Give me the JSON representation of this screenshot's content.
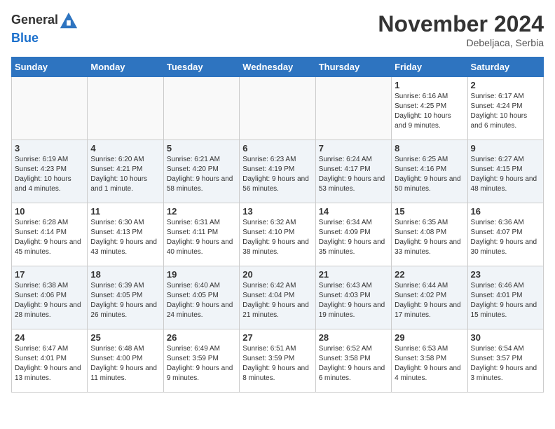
{
  "header": {
    "logo_general": "General",
    "logo_blue": "Blue",
    "month_title": "November 2024",
    "location": "Debeljaca, Serbia"
  },
  "weekdays": [
    "Sunday",
    "Monday",
    "Tuesday",
    "Wednesday",
    "Thursday",
    "Friday",
    "Saturday"
  ],
  "weeks": [
    [
      {
        "day": "",
        "info": ""
      },
      {
        "day": "",
        "info": ""
      },
      {
        "day": "",
        "info": ""
      },
      {
        "day": "",
        "info": ""
      },
      {
        "day": "",
        "info": ""
      },
      {
        "day": "1",
        "info": "Sunrise: 6:16 AM\nSunset: 4:25 PM\nDaylight: 10 hours and 9 minutes."
      },
      {
        "day": "2",
        "info": "Sunrise: 6:17 AM\nSunset: 4:24 PM\nDaylight: 10 hours and 6 minutes."
      }
    ],
    [
      {
        "day": "3",
        "info": "Sunrise: 6:19 AM\nSunset: 4:23 PM\nDaylight: 10 hours and 4 minutes."
      },
      {
        "day": "4",
        "info": "Sunrise: 6:20 AM\nSunset: 4:21 PM\nDaylight: 10 hours and 1 minute."
      },
      {
        "day": "5",
        "info": "Sunrise: 6:21 AM\nSunset: 4:20 PM\nDaylight: 9 hours and 58 minutes."
      },
      {
        "day": "6",
        "info": "Sunrise: 6:23 AM\nSunset: 4:19 PM\nDaylight: 9 hours and 56 minutes."
      },
      {
        "day": "7",
        "info": "Sunrise: 6:24 AM\nSunset: 4:17 PM\nDaylight: 9 hours and 53 minutes."
      },
      {
        "day": "8",
        "info": "Sunrise: 6:25 AM\nSunset: 4:16 PM\nDaylight: 9 hours and 50 minutes."
      },
      {
        "day": "9",
        "info": "Sunrise: 6:27 AM\nSunset: 4:15 PM\nDaylight: 9 hours and 48 minutes."
      }
    ],
    [
      {
        "day": "10",
        "info": "Sunrise: 6:28 AM\nSunset: 4:14 PM\nDaylight: 9 hours and 45 minutes."
      },
      {
        "day": "11",
        "info": "Sunrise: 6:30 AM\nSunset: 4:13 PM\nDaylight: 9 hours and 43 minutes."
      },
      {
        "day": "12",
        "info": "Sunrise: 6:31 AM\nSunset: 4:11 PM\nDaylight: 9 hours and 40 minutes."
      },
      {
        "day": "13",
        "info": "Sunrise: 6:32 AM\nSunset: 4:10 PM\nDaylight: 9 hours and 38 minutes."
      },
      {
        "day": "14",
        "info": "Sunrise: 6:34 AM\nSunset: 4:09 PM\nDaylight: 9 hours and 35 minutes."
      },
      {
        "day": "15",
        "info": "Sunrise: 6:35 AM\nSunset: 4:08 PM\nDaylight: 9 hours and 33 minutes."
      },
      {
        "day": "16",
        "info": "Sunrise: 6:36 AM\nSunset: 4:07 PM\nDaylight: 9 hours and 30 minutes."
      }
    ],
    [
      {
        "day": "17",
        "info": "Sunrise: 6:38 AM\nSunset: 4:06 PM\nDaylight: 9 hours and 28 minutes."
      },
      {
        "day": "18",
        "info": "Sunrise: 6:39 AM\nSunset: 4:05 PM\nDaylight: 9 hours and 26 minutes."
      },
      {
        "day": "19",
        "info": "Sunrise: 6:40 AM\nSunset: 4:05 PM\nDaylight: 9 hours and 24 minutes."
      },
      {
        "day": "20",
        "info": "Sunrise: 6:42 AM\nSunset: 4:04 PM\nDaylight: 9 hours and 21 minutes."
      },
      {
        "day": "21",
        "info": "Sunrise: 6:43 AM\nSunset: 4:03 PM\nDaylight: 9 hours and 19 minutes."
      },
      {
        "day": "22",
        "info": "Sunrise: 6:44 AM\nSunset: 4:02 PM\nDaylight: 9 hours and 17 minutes."
      },
      {
        "day": "23",
        "info": "Sunrise: 6:46 AM\nSunset: 4:01 PM\nDaylight: 9 hours and 15 minutes."
      }
    ],
    [
      {
        "day": "24",
        "info": "Sunrise: 6:47 AM\nSunset: 4:01 PM\nDaylight: 9 hours and 13 minutes."
      },
      {
        "day": "25",
        "info": "Sunrise: 6:48 AM\nSunset: 4:00 PM\nDaylight: 9 hours and 11 minutes."
      },
      {
        "day": "26",
        "info": "Sunrise: 6:49 AM\nSunset: 3:59 PM\nDaylight: 9 hours and 9 minutes."
      },
      {
        "day": "27",
        "info": "Sunrise: 6:51 AM\nSunset: 3:59 PM\nDaylight: 9 hours and 8 minutes."
      },
      {
        "day": "28",
        "info": "Sunrise: 6:52 AM\nSunset: 3:58 PM\nDaylight: 9 hours and 6 minutes."
      },
      {
        "day": "29",
        "info": "Sunrise: 6:53 AM\nSunset: 3:58 PM\nDaylight: 9 hours and 4 minutes."
      },
      {
        "day": "30",
        "info": "Sunrise: 6:54 AM\nSunset: 3:57 PM\nDaylight: 9 hours and 3 minutes."
      }
    ]
  ]
}
